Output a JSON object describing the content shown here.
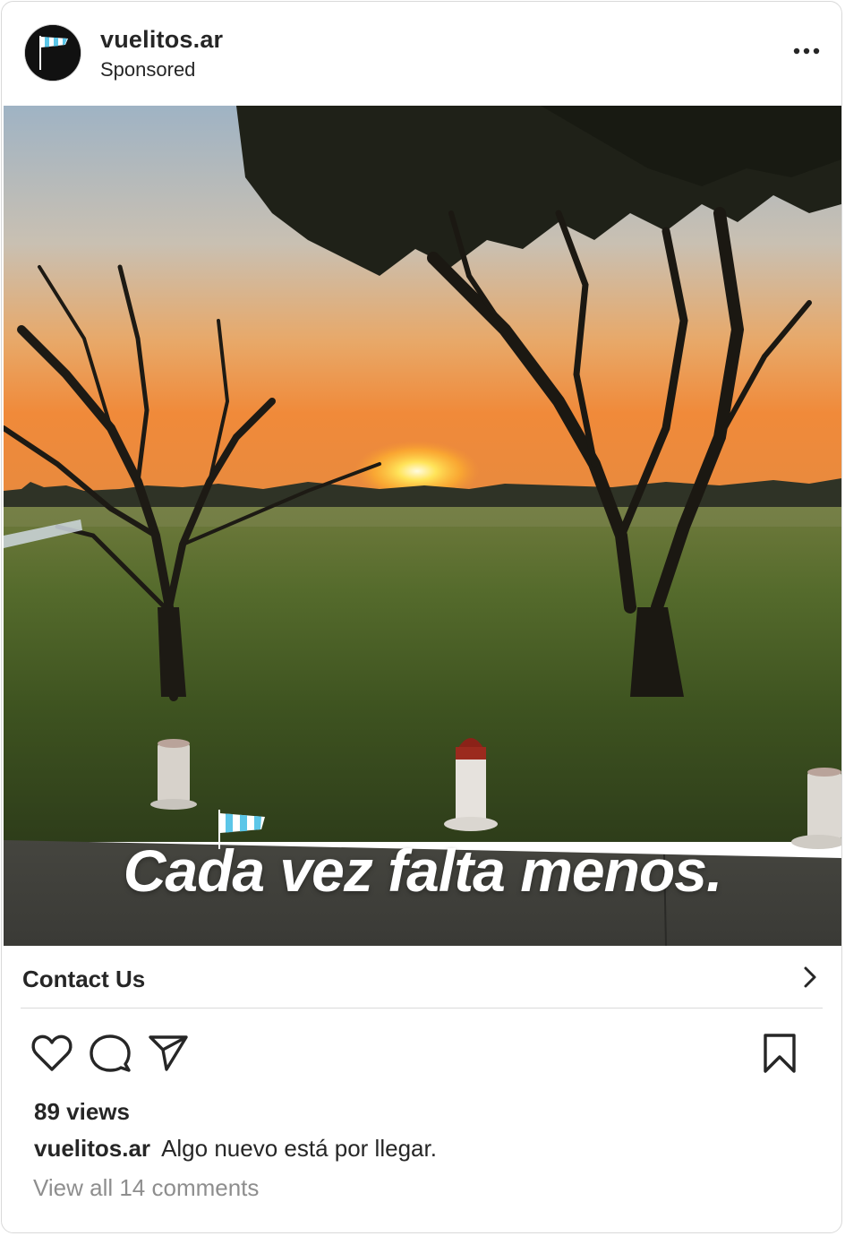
{
  "header": {
    "username": "vuelitos.ar",
    "sponsored": "Sponsored",
    "avatar_icon": "windsock-icon",
    "more_icon": "more-horizontal-icon"
  },
  "media": {
    "overlay_text": "Cada vez falta menos."
  },
  "cta": {
    "label": "Contact Us",
    "chevron_icon": "chevron-right-icon"
  },
  "actions": {
    "like_icon": "heart-icon",
    "comment_icon": "comment-icon",
    "share_icon": "send-icon",
    "save_icon": "bookmark-icon"
  },
  "stats": {
    "views": "89 views"
  },
  "caption": {
    "username": "vuelitos.ar",
    "text": "Algo nuevo está por llegar."
  },
  "comments": {
    "link": "View all 14 comments"
  },
  "colors": {
    "text": "#262626",
    "muted": "#8e8e8e",
    "windsock_blue": "#5bc6e8"
  }
}
